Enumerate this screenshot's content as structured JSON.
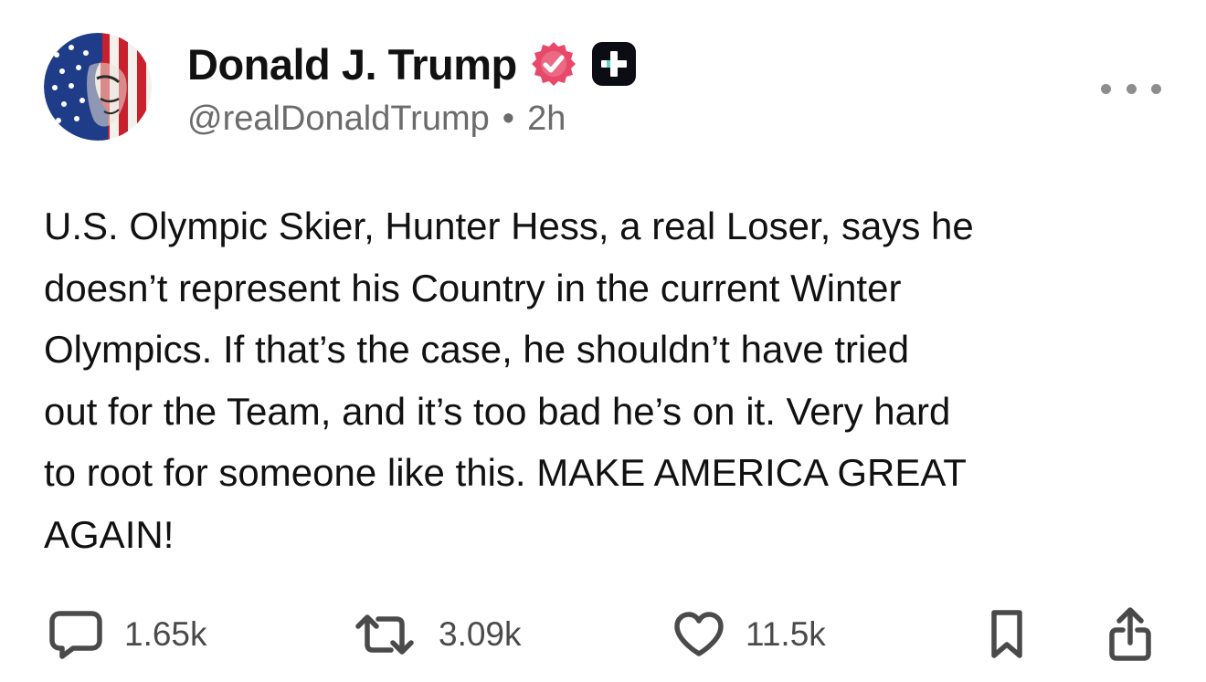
{
  "post": {
    "author": {
      "display_name": "Donald J. Trump",
      "handle": "@realDonaldTrump",
      "time_separator": "•",
      "timestamp": "2h",
      "verified": true,
      "badge_icon": "plus-badge-icon"
    },
    "text": "U.S. Olympic Skier, Hunter Hess, a real Loser, says he\ndoesn’t represent his Country in the current Winter\nOlympics. If that’s the case, he shouldn’t have tried\nout for the Team, and it’s too bad he’s on it. Very hard\nto root for someone like this. MAKE AMERICA GREAT\nAGAIN!",
    "actions": {
      "replies": "1.65k",
      "reposts": "3.09k",
      "likes": "11.5k"
    }
  },
  "colors": {
    "verified_badge": "#e8496a",
    "plus_badge": "#0c0c14",
    "text_primary": "#111111",
    "text_secondary": "#6b6b6b",
    "icon": "#4a4a4a"
  },
  "icons": {
    "more": "more-icon",
    "reply": "reply-icon",
    "repost": "repost-icon",
    "like": "heart-icon",
    "bookmark": "bookmark-icon",
    "share": "share-icon"
  }
}
